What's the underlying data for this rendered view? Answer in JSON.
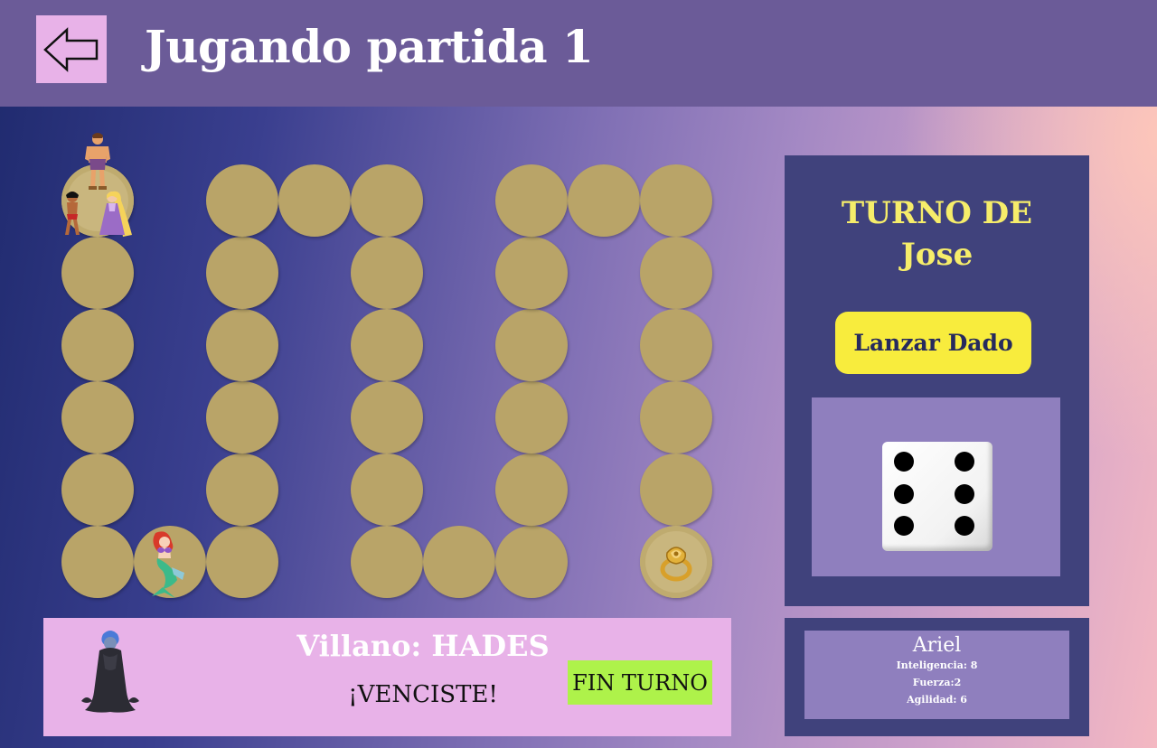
{
  "header": {
    "title": "Jugando partida 1",
    "back_icon": "arrow-left-icon"
  },
  "board": {
    "cell_color": "#b9a468",
    "tokens": [
      {
        "name": "hercules-token",
        "label": "Hercules"
      },
      {
        "name": "mowgli-token",
        "label": "Mowgli"
      },
      {
        "name": "rapunzel-token",
        "label": "Rapunzel"
      },
      {
        "name": "ariel-token",
        "label": "Ariel"
      },
      {
        "name": "ring-goal-token",
        "label": "Anillo"
      }
    ]
  },
  "turn": {
    "title": "TURNO DE",
    "player": "Jose",
    "roll_label": "Lanzar Dado",
    "dice_value": 6
  },
  "villain": {
    "title": "Villano: HADES",
    "result": "¡VENCISTE!",
    "end_turn_label": "FIN TURNO"
  },
  "stats": {
    "name": "Ariel",
    "lines": [
      "Inteligencia: 8",
      "Fuerza:2",
      "Agilidad: 6"
    ]
  },
  "colors": {
    "header": "#6b5b98",
    "panel": "#40427c",
    "accent_yellow": "#f6ed6a",
    "button_yellow": "#f8ec3d",
    "pink": "#e8b2e8",
    "green": "#aef24a",
    "lavender": "#8f7fbe"
  }
}
